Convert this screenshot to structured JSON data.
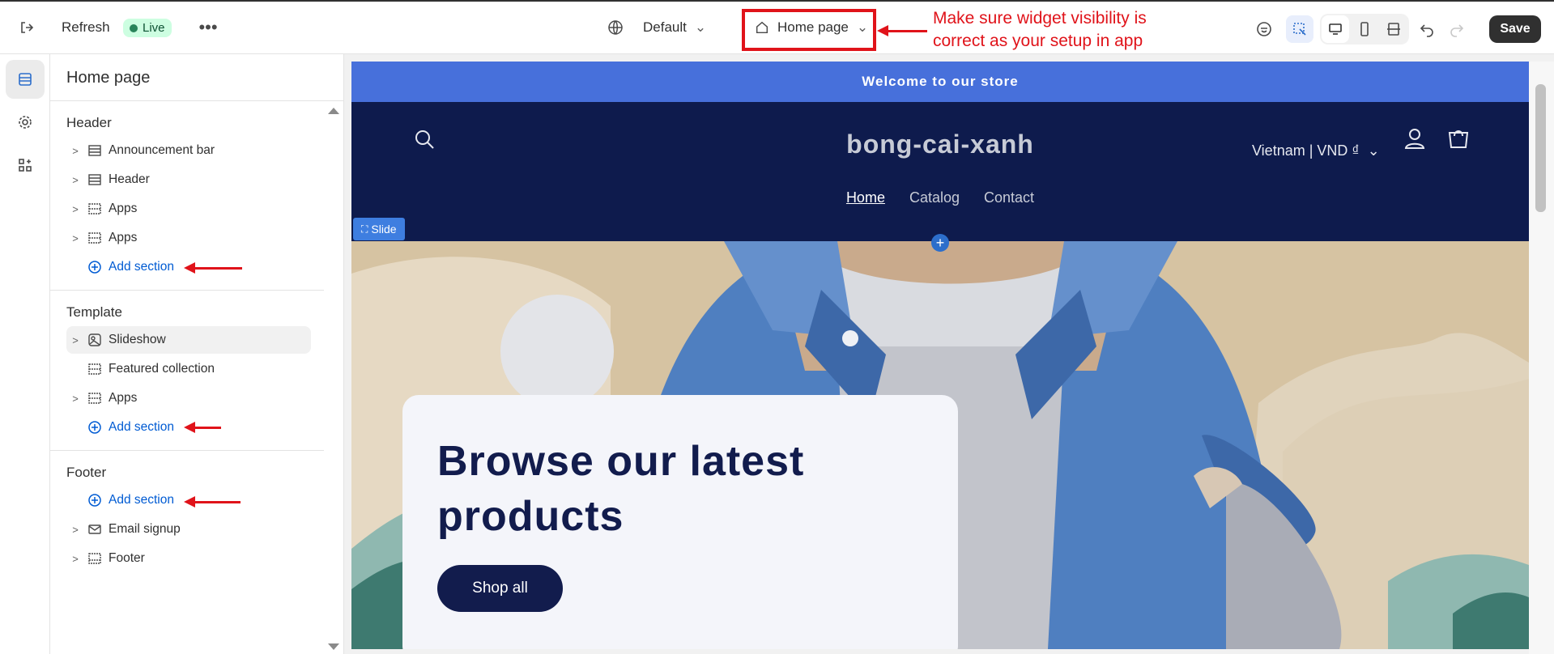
{
  "topbar": {
    "refresh_label": "Refresh",
    "live_label": "Live",
    "theme_label": "Default",
    "page_label": "Home page",
    "save_label": "Save"
  },
  "annotation": {
    "text": "Make sure widget visibility is correct as your setup in app",
    "color": "#e0131a"
  },
  "panel": {
    "title": "Home page",
    "groups": {
      "header": {
        "title": "Header",
        "items": [
          "Announcement bar",
          "Header",
          "Apps",
          "Apps"
        ],
        "add_label": "Add section"
      },
      "template": {
        "title": "Template",
        "items": [
          "Slideshow",
          "Featured collection",
          "Apps"
        ],
        "add_label": "Add section"
      },
      "footer": {
        "title": "Footer",
        "add_label": "Add section",
        "items": [
          "Email signup",
          "Footer"
        ]
      }
    }
  },
  "preview": {
    "announcement": "Welcome to our store",
    "brand": "bong-cai-xanh",
    "nav": [
      "Home",
      "Catalog",
      "Contact"
    ],
    "locale": "Vietnam | VND ₫",
    "slide_tag": "Slide",
    "hero_heading": "Browse our latest products",
    "hero_button": "Shop all"
  },
  "colors": {
    "accent": "#005bd3",
    "announce_bg": "#4770db",
    "header_bg": "#0e1b4d",
    "live_bg": "#cdfee1"
  }
}
